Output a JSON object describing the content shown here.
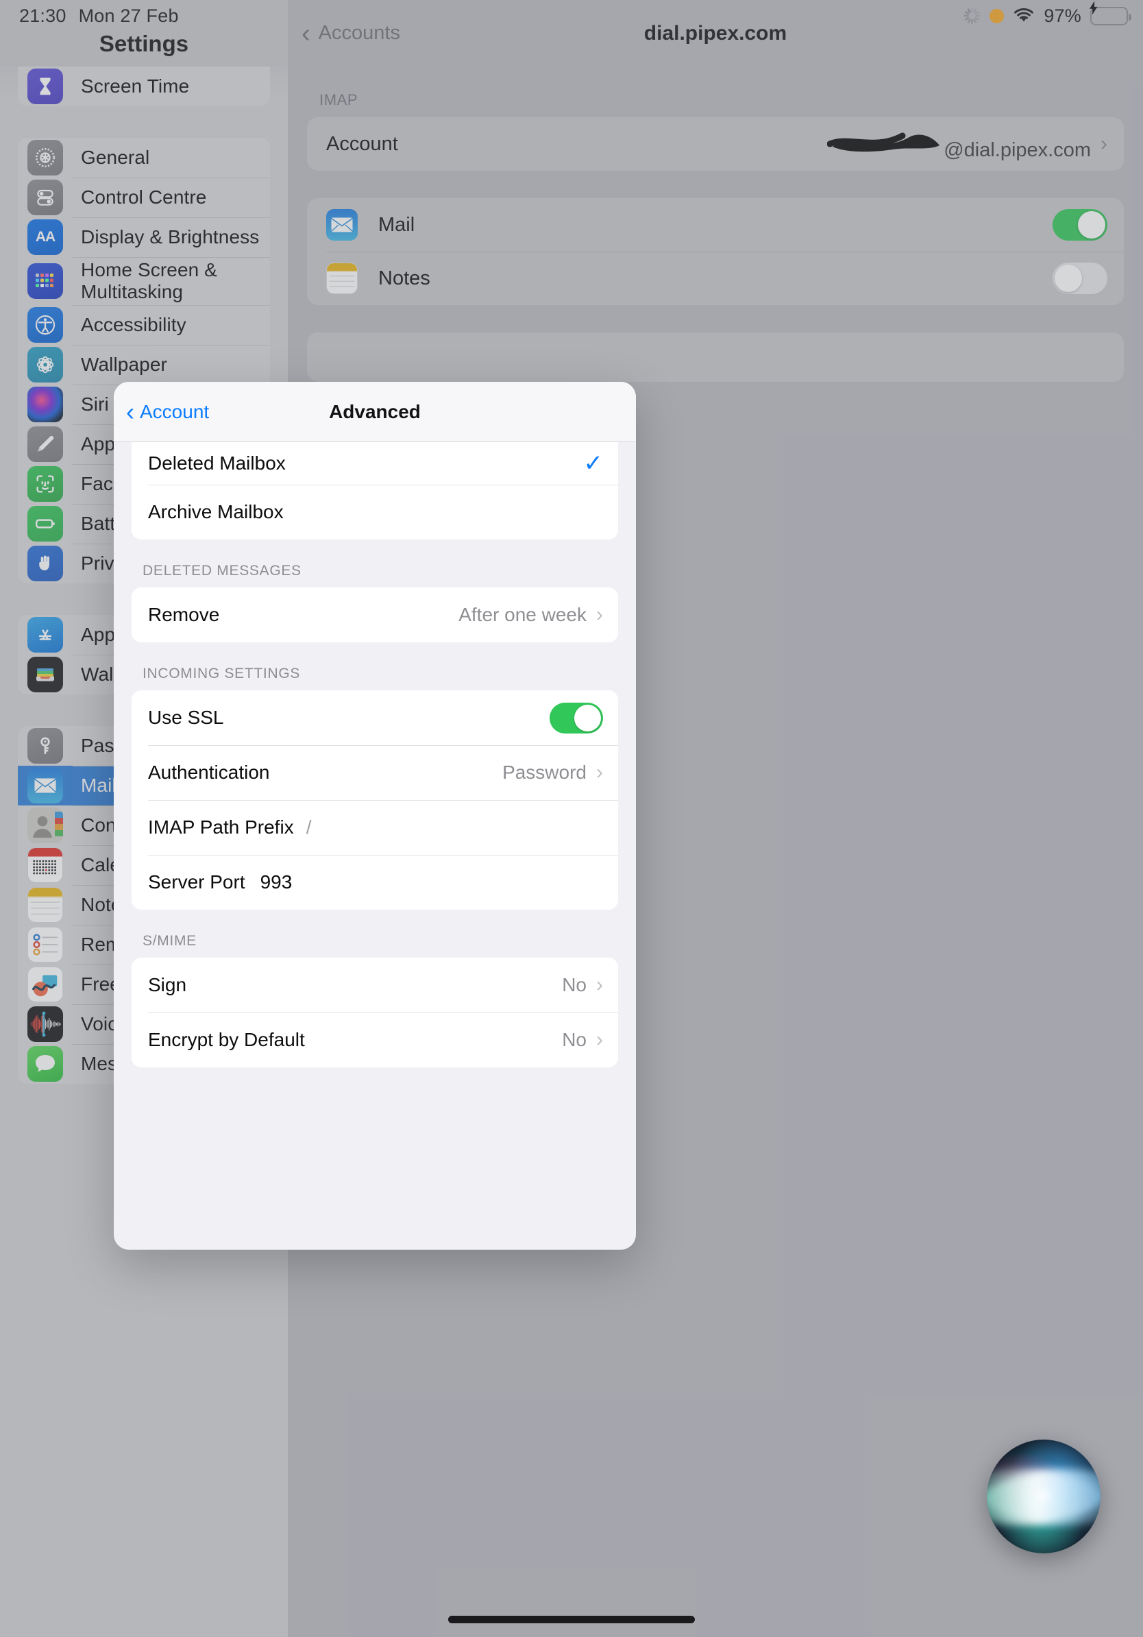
{
  "status_bar": {
    "time": "21:30",
    "date": "Mon 27 Feb",
    "battery_percent": "97%",
    "icons": [
      "activity-spinner-icon",
      "orange-privacy-dot-icon",
      "wifi-icon",
      "battery-charging-icon"
    ]
  },
  "sidebar": {
    "title": "Settings",
    "groups": [
      {
        "items": [
          {
            "label": "Screen Time",
            "icon": "hourglass-icon",
            "icon_class": "ic-screentime",
            "selected": false
          }
        ]
      },
      {
        "items": [
          {
            "label": "General",
            "icon": "gear-icon",
            "icon_class": "ic-general",
            "selected": false
          },
          {
            "label": "Control Centre",
            "icon": "sliders-icon",
            "icon_class": "ic-control",
            "selected": false
          },
          {
            "label": "Display & Brightness",
            "icon": "aa-icon",
            "icon_class": "ic-display",
            "selected": false
          },
          {
            "label": "Home Screen &\nMultitasking",
            "icon": "app-grid-icon",
            "icon_class": "ic-home",
            "selected": false,
            "tall": true
          },
          {
            "label": "Accessibility",
            "icon": "accessibility-icon",
            "icon_class": "ic-access",
            "selected": false
          },
          {
            "label": "Wallpaper",
            "icon": "flower-icon",
            "icon_class": "ic-wallpaper",
            "selected": false
          },
          {
            "label": "Siri & Search",
            "icon": "siri-icon",
            "icon_class": "ic-siri",
            "selected": false
          },
          {
            "label": "Apple Pencil",
            "icon": "pencil-icon",
            "icon_class": "ic-pencil",
            "selected": false
          },
          {
            "label": "Face ID & Passcode",
            "icon": "face-id-icon",
            "icon_class": "ic-faceid",
            "selected": false
          },
          {
            "label": "Battery",
            "icon": "battery-icon",
            "icon_class": "ic-battery",
            "selected": false
          },
          {
            "label": "Privacy & Security",
            "icon": "hand-icon",
            "icon_class": "ic-privacy",
            "selected": false
          }
        ]
      },
      {
        "items": [
          {
            "label": "App Store",
            "icon": "app-store-icon",
            "icon_class": "ic-appstore",
            "selected": false
          },
          {
            "label": "Wallet & Apple Pay",
            "icon": "wallet-icon",
            "icon_class": "ic-wallet",
            "selected": false
          }
        ]
      },
      {
        "items": [
          {
            "label": "Passwords",
            "icon": "key-icon",
            "icon_class": "ic-passwords",
            "selected": false
          },
          {
            "label": "Mail",
            "icon": "mail-icon",
            "icon_class": "ic-mail",
            "selected": true
          },
          {
            "label": "Contacts",
            "icon": "contacts-icon",
            "icon_class": "ic-contacts",
            "selected": false
          },
          {
            "label": "Calendar",
            "icon": "calendar-icon",
            "icon_class": "ic-calendar",
            "selected": false
          },
          {
            "label": "Notes",
            "icon": "notes-icon",
            "icon_class": "ic-notes",
            "selected": false
          },
          {
            "label": "Reminders",
            "icon": "reminders-icon",
            "icon_class": "ic-reminders",
            "selected": false
          },
          {
            "label": "Freeform",
            "icon": "freeform-icon",
            "icon_class": "ic-freeform",
            "selected": false
          },
          {
            "label": "Voice Memos",
            "icon": "voice-memos-icon",
            "icon_class": "ic-voicememos",
            "selected": false
          },
          {
            "label": "Messages",
            "icon": "messages-icon",
            "icon_class": "ic-messages",
            "selected": false
          }
        ]
      }
    ]
  },
  "detail": {
    "back_label": "Accounts",
    "title": "dial.pipex.com",
    "section_label": "IMAP",
    "account_row": {
      "label": "Account",
      "value_suffix": "@dial.pipex.com",
      "value_redacted": true
    },
    "services": [
      {
        "label": "Mail",
        "icon": "mail-icon",
        "icon_class": "ic-mail",
        "toggle": "on"
      },
      {
        "label": "Notes",
        "icon": "notes-icon",
        "icon_class": "ic-notes",
        "toggle": "off"
      }
    ]
  },
  "modal": {
    "back_label": "Account",
    "title": "Advanced",
    "mailbox_rows": [
      {
        "label": "Deleted Mailbox",
        "checked": true
      },
      {
        "label": "Archive Mailbox",
        "checked": false
      }
    ],
    "deleted_messages": {
      "section_label": "DELETED MESSAGES",
      "rows": [
        {
          "label": "Remove",
          "value": "After one week",
          "chevron": true
        }
      ]
    },
    "incoming_settings": {
      "section_label": "INCOMING SETTINGS",
      "use_ssl": {
        "label": "Use SSL",
        "toggle": "on"
      },
      "authentication": {
        "label": "Authentication",
        "value": "Password",
        "chevron": true
      },
      "imap_path_prefix": {
        "label": "IMAP Path Prefix",
        "value": "/"
      },
      "server_port": {
        "label": "Server Port",
        "value": "993"
      }
    },
    "smime": {
      "section_label": "S/MIME",
      "rows": [
        {
          "label": "Sign",
          "value": "No",
          "chevron": true
        },
        {
          "label": "Encrypt by Default",
          "value": "No",
          "chevron": true
        }
      ]
    }
  },
  "overlays": {
    "siri_orb": "siri-orb-icon",
    "home_indicator": "home-indicator"
  },
  "colors": {
    "accent_blue": "#0a7cff",
    "selected_row": "#2f7ed8",
    "toggle_on": "#32c759",
    "battery_green": "#32d74b",
    "privacy_dot": "#f5a623"
  }
}
